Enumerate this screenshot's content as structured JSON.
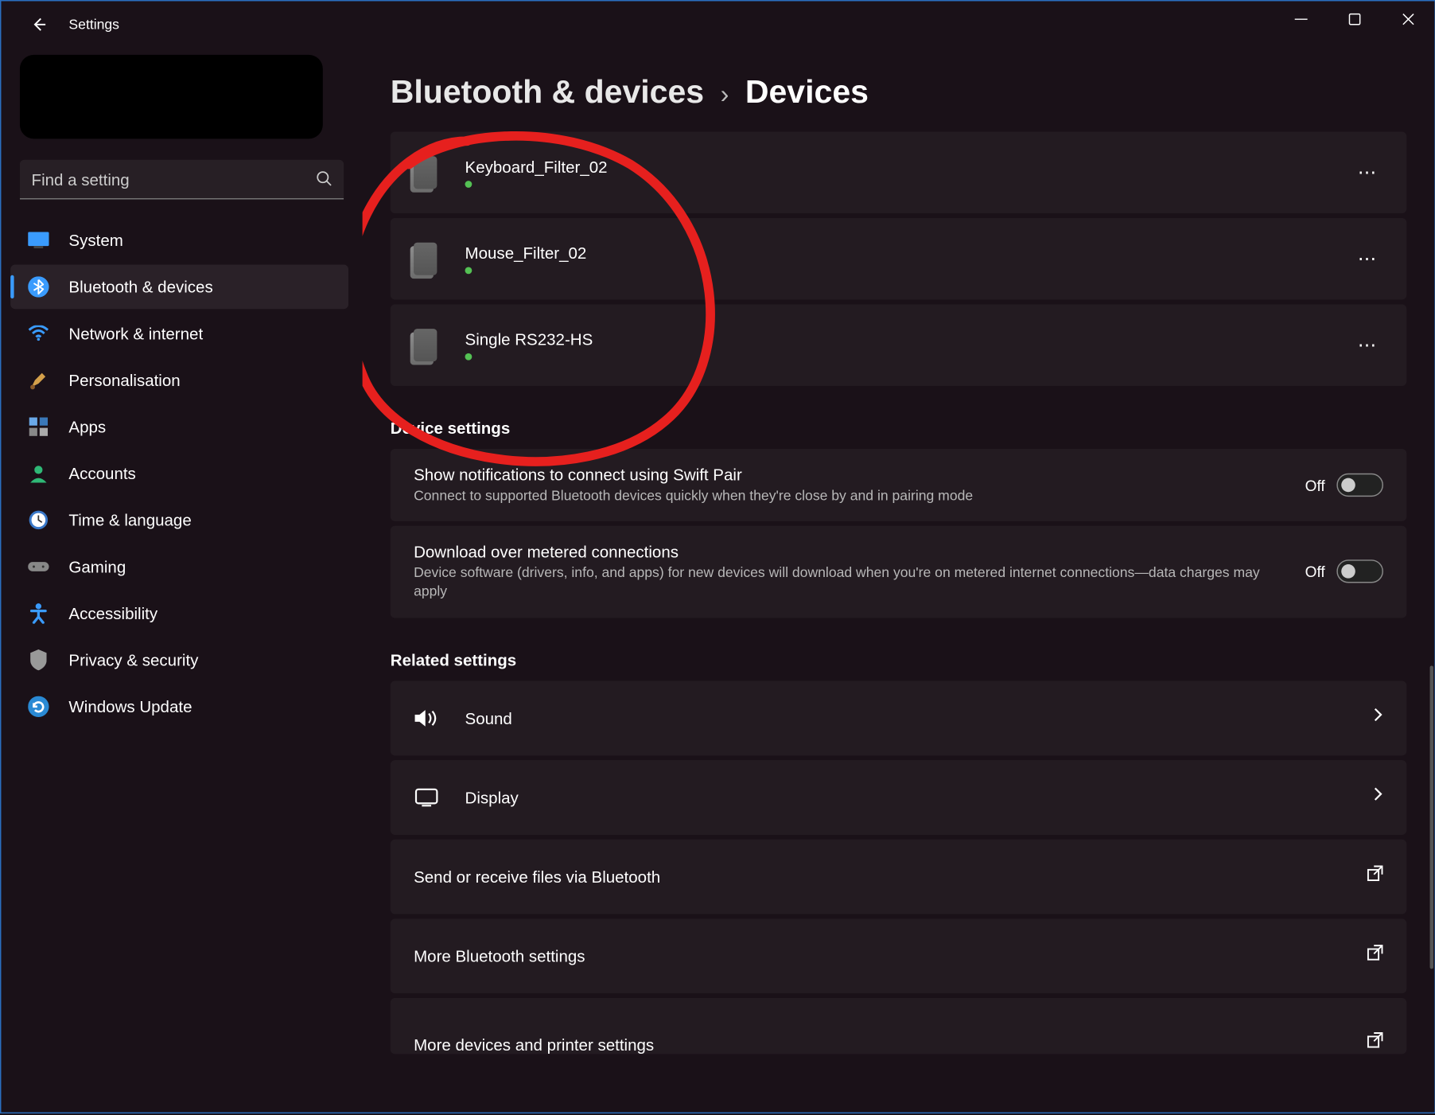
{
  "window": {
    "title": "Settings"
  },
  "search": {
    "placeholder": "Find a setting"
  },
  "sidebar": {
    "items": [
      {
        "label": "System"
      },
      {
        "label": "Bluetooth & devices"
      },
      {
        "label": "Network & internet"
      },
      {
        "label": "Personalisation"
      },
      {
        "label": "Apps"
      },
      {
        "label": "Accounts"
      },
      {
        "label": "Time & language"
      },
      {
        "label": "Gaming"
      },
      {
        "label": "Accessibility"
      },
      {
        "label": "Privacy & security"
      },
      {
        "label": "Windows Update"
      }
    ]
  },
  "breadcrumb": {
    "parent": "Bluetooth & devices",
    "current": "Devices"
  },
  "devices": [
    {
      "name": "Keyboard_Filter_02"
    },
    {
      "name": "Mouse_Filter_02"
    },
    {
      "name": "Single RS232-HS"
    }
  ],
  "sections": {
    "device_settings": "Device settings",
    "related": "Related settings"
  },
  "toggles": [
    {
      "title": "Show notifications to connect using Swift Pair",
      "desc": "Connect to supported Bluetooth devices quickly when they're close by and in pairing mode",
      "state": "Off"
    },
    {
      "title": "Download over metered connections",
      "desc": "Device software (drivers, info, and apps) for new devices will download when you're on metered internet connections—data charges may apply",
      "state": "Off"
    }
  ],
  "related": [
    {
      "title": "Sound",
      "icon": "speaker",
      "link": "chev"
    },
    {
      "title": "Display",
      "icon": "display",
      "link": "chev"
    },
    {
      "title": "Send or receive files via Bluetooth",
      "icon": "",
      "link": "ext"
    },
    {
      "title": "More Bluetooth settings",
      "icon": "",
      "link": "ext"
    },
    {
      "title": "More devices and printer settings",
      "icon": "",
      "link": "ext"
    }
  ]
}
